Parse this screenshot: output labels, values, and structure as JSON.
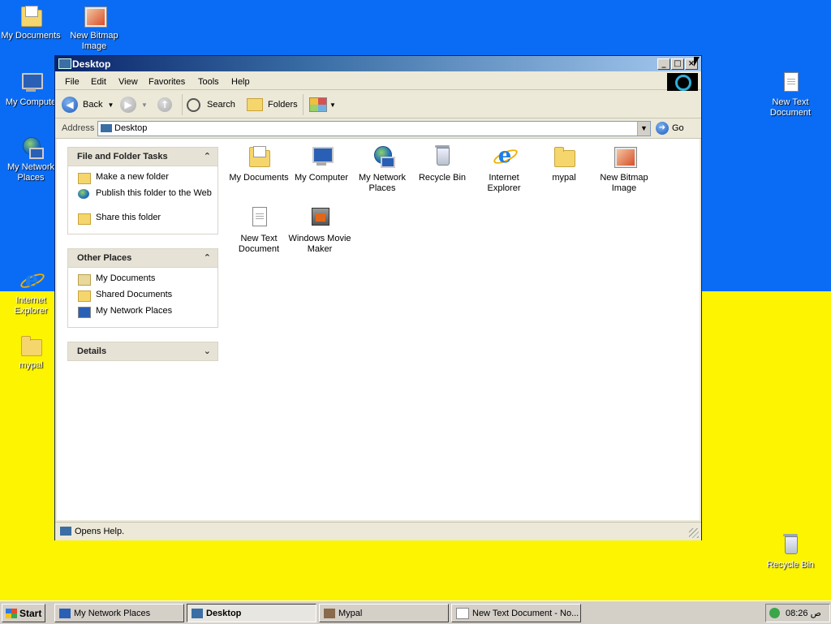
{
  "desktop": {
    "icons": [
      {
        "label": "My Documents",
        "icon": "my-documents-icon"
      },
      {
        "label": "New Bitmap Image",
        "icon": "bitmap-icon"
      },
      {
        "label": "My Compute",
        "icon": "my-computer-icon"
      },
      {
        "label": "My Network Places",
        "icon": "network-places-icon"
      },
      {
        "label": "Internet Explorer",
        "icon": "internet-explorer-icon"
      },
      {
        "label": "mypal",
        "icon": "folder-icon"
      },
      {
        "label": "New Text Document",
        "icon": "text-document-icon"
      },
      {
        "label": "Recycle Bin",
        "icon": "recycle-bin-icon"
      }
    ],
    "wallpaper_colors": {
      "top": "#0a6cf5",
      "bottom": "#fcf400"
    }
  },
  "window": {
    "title": "Desktop",
    "controls": {
      "minimize": "_",
      "maximize": "□",
      "close": "×"
    },
    "menu": [
      "File",
      "Edit",
      "View",
      "Favorites",
      "Tools",
      "Help"
    ],
    "toolbar": {
      "back": "Back",
      "search": "Search",
      "folders": "Folders"
    },
    "address": {
      "label": "Address",
      "value": "Desktop",
      "go": "Go"
    },
    "panels": {
      "file_tasks": {
        "title": "File and Folder Tasks",
        "items": [
          "Make a new folder",
          "Publish this folder to the Web",
          "Share this folder"
        ]
      },
      "other_places": {
        "title": "Other Places",
        "items": [
          "My Documents",
          "Shared Documents",
          "My Network Places"
        ]
      },
      "details": {
        "title": "Details"
      }
    },
    "items": [
      {
        "label": "My Documents",
        "icon": "my-documents-icon"
      },
      {
        "label": "My Computer",
        "icon": "my-computer-icon"
      },
      {
        "label": "My Network Places",
        "icon": "network-places-icon"
      },
      {
        "label": "Recycle Bin",
        "icon": "recycle-bin-icon"
      },
      {
        "label": "Internet Explorer",
        "icon": "internet-explorer-icon"
      },
      {
        "label": "mypal",
        "icon": "folder-icon"
      },
      {
        "label": "New Bitmap Image",
        "icon": "bitmap-icon"
      },
      {
        "label": "New Text Document",
        "icon": "text-document-icon"
      },
      {
        "label": "Windows Movie Maker",
        "icon": "movie-maker-icon"
      }
    ],
    "status": "Opens Help."
  },
  "taskbar": {
    "start": "Start",
    "tasks": [
      {
        "label": "My Network Places",
        "active": false
      },
      {
        "label": "Desktop",
        "active": true
      },
      {
        "label": "Mypal",
        "active": false
      },
      {
        "label": "New Text Document - No...",
        "active": false
      }
    ],
    "clock": "08:26 ص"
  }
}
